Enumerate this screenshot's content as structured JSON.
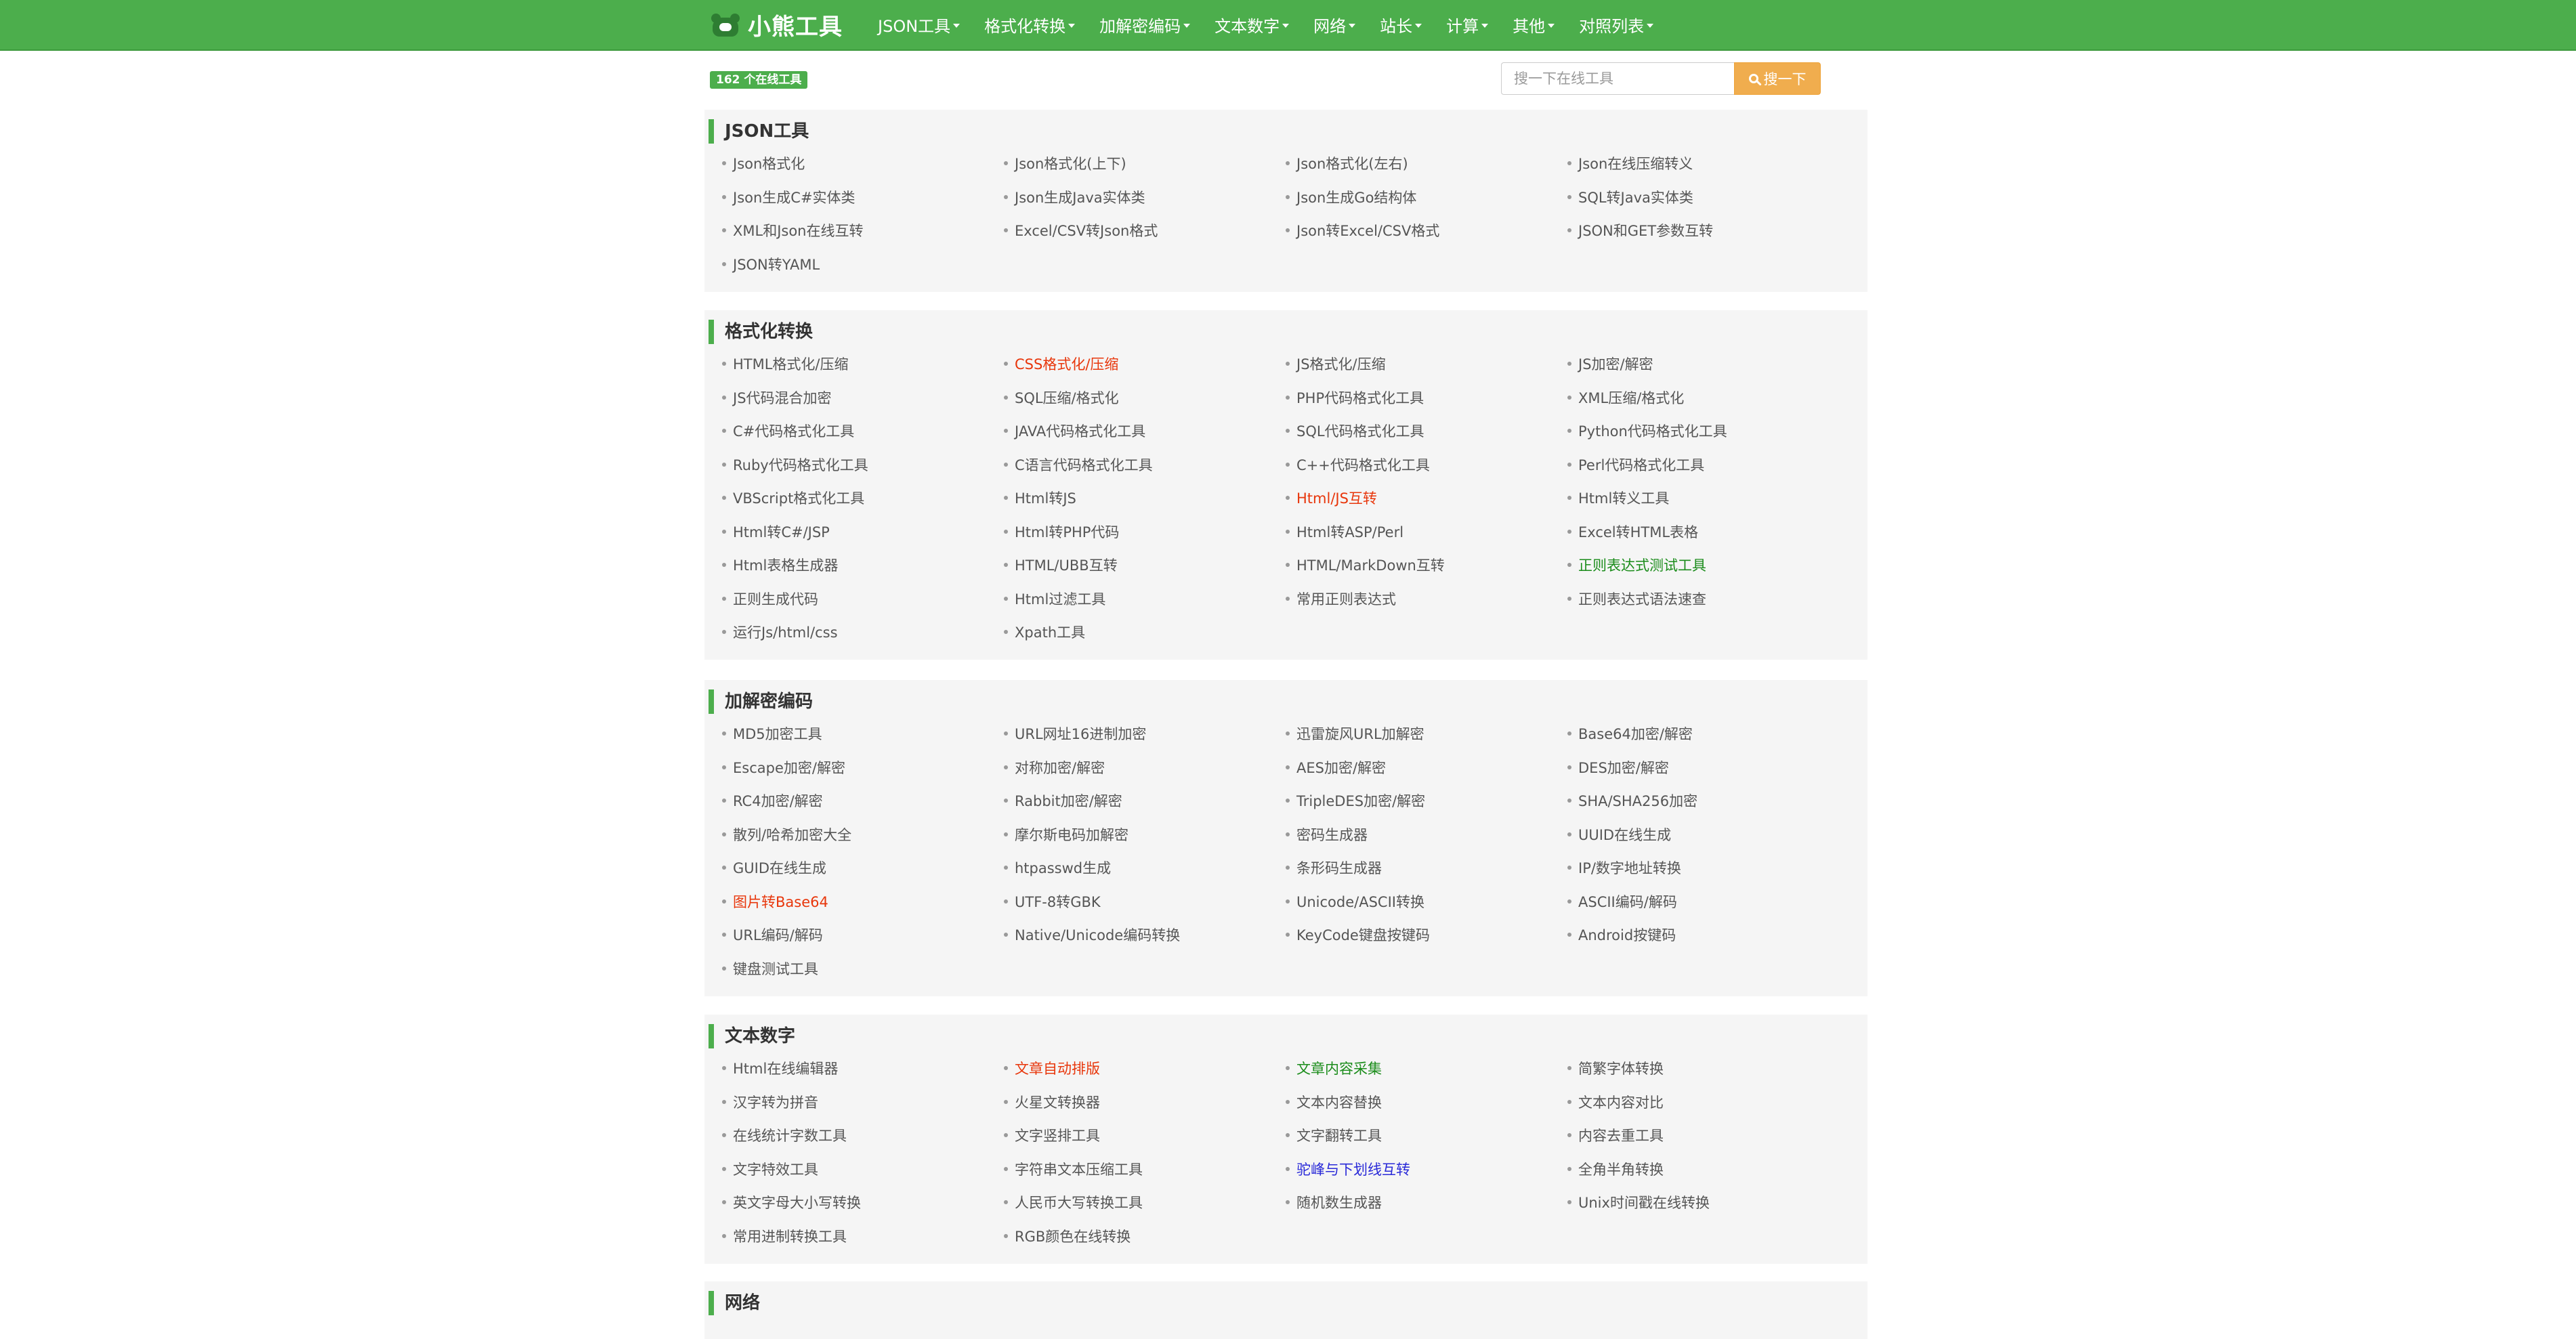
{
  "brand": {
    "name": "小熊工具",
    "logo_icon": "bear-icon"
  },
  "nav": [
    {
      "label": "JSON工具"
    },
    {
      "label": "格式化转换"
    },
    {
      "label": "加解密编码"
    },
    {
      "label": "文本数字"
    },
    {
      "label": "网络"
    },
    {
      "label": "站长"
    },
    {
      "label": "计算"
    },
    {
      "label": "其他"
    },
    {
      "label": "对照列表"
    }
  ],
  "toolbar": {
    "tool_count": "162 个在线工具",
    "search_placeholder": "搜一下在线工具",
    "search_label": "搜一下"
  },
  "colors": {
    "accent": "#4cae4c",
    "search_button": "#f0ad4e",
    "red": "#e8360b",
    "green": "#1a8c1a",
    "blue": "#2a2ad8"
  },
  "sections": [
    {
      "title": "JSON工具",
      "items": [
        {
          "label": "Json格式化",
          "color": "default"
        },
        {
          "label": "Json格式化(上下)",
          "color": "default"
        },
        {
          "label": "Json格式化(左右)",
          "color": "default"
        },
        {
          "label": "Json在线压缩转义",
          "color": "default"
        },
        {
          "label": "Json生成C#实体类",
          "color": "default"
        },
        {
          "label": "Json生成Java实体类",
          "color": "default"
        },
        {
          "label": "Json生成Go结构体",
          "color": "default"
        },
        {
          "label": "SQL转Java实体类",
          "color": "default"
        },
        {
          "label": "XML和Json在线互转",
          "color": "default"
        },
        {
          "label": "Excel/CSV转Json格式",
          "color": "default"
        },
        {
          "label": "Json转Excel/CSV格式",
          "color": "default"
        },
        {
          "label": "JSON和GET参数互转",
          "color": "default"
        },
        {
          "label": "JSON转YAML",
          "color": "default"
        }
      ]
    },
    {
      "title": "格式化转换",
      "items": [
        {
          "label": "HTML格式化/压缩",
          "color": "default"
        },
        {
          "label": "CSS格式化/压缩",
          "color": "red"
        },
        {
          "label": "JS格式化/压缩",
          "color": "default"
        },
        {
          "label": "JS加密/解密",
          "color": "default"
        },
        {
          "label": "JS代码混合加密",
          "color": "default"
        },
        {
          "label": "SQL压缩/格式化",
          "color": "default"
        },
        {
          "label": "PHP代码格式化工具",
          "color": "default"
        },
        {
          "label": "XML压缩/格式化",
          "color": "default"
        },
        {
          "label": "C#代码格式化工具",
          "color": "default"
        },
        {
          "label": "JAVA代码格式化工具",
          "color": "default"
        },
        {
          "label": "SQL代码格式化工具",
          "color": "default"
        },
        {
          "label": "Python代码格式化工具",
          "color": "default"
        },
        {
          "label": "Ruby代码格式化工具",
          "color": "default"
        },
        {
          "label": "C语言代码格式化工具",
          "color": "default"
        },
        {
          "label": "C++代码格式化工具",
          "color": "default"
        },
        {
          "label": "Perl代码格式化工具",
          "color": "default"
        },
        {
          "label": "VBScript格式化工具",
          "color": "default"
        },
        {
          "label": "Html转JS",
          "color": "default"
        },
        {
          "label": "Html/JS互转",
          "color": "red"
        },
        {
          "label": "Html转义工具",
          "color": "default"
        },
        {
          "label": "Html转C#/JSP",
          "color": "default"
        },
        {
          "label": "Html转PHP代码",
          "color": "default"
        },
        {
          "label": "Html转ASP/Perl",
          "color": "default"
        },
        {
          "label": "Excel转HTML表格",
          "color": "default"
        },
        {
          "label": "Html表格生成器",
          "color": "default"
        },
        {
          "label": "HTML/UBB互转",
          "color": "default"
        },
        {
          "label": "HTML/MarkDown互转",
          "color": "default"
        },
        {
          "label": "正则表达式测试工具",
          "color": "green"
        },
        {
          "label": "正则生成代码",
          "color": "default"
        },
        {
          "label": "Html过滤工具",
          "color": "default"
        },
        {
          "label": "常用正则表达式",
          "color": "default"
        },
        {
          "label": "正则表达式语法速查",
          "color": "default"
        },
        {
          "label": "运行Js/html/css",
          "color": "default"
        },
        {
          "label": "Xpath工具",
          "color": "default"
        }
      ]
    },
    {
      "title": "加解密编码",
      "items": [
        {
          "label": "MD5加密工具",
          "color": "default"
        },
        {
          "label": "URL网址16进制加密",
          "color": "default"
        },
        {
          "label": "迅雷旋风URL加解密",
          "color": "default"
        },
        {
          "label": "Base64加密/解密",
          "color": "default"
        },
        {
          "label": "Escape加密/解密",
          "color": "default"
        },
        {
          "label": "对称加密/解密",
          "color": "default"
        },
        {
          "label": "AES加密/解密",
          "color": "default"
        },
        {
          "label": "DES加密/解密",
          "color": "default"
        },
        {
          "label": "RC4加密/解密",
          "color": "default"
        },
        {
          "label": "Rabbit加密/解密",
          "color": "default"
        },
        {
          "label": "TripleDES加密/解密",
          "color": "default"
        },
        {
          "label": "SHA/SHA256加密",
          "color": "default"
        },
        {
          "label": "散列/哈希加密大全",
          "color": "default"
        },
        {
          "label": "摩尔斯电码加解密",
          "color": "default"
        },
        {
          "label": "密码生成器",
          "color": "default"
        },
        {
          "label": "UUID在线生成",
          "color": "default"
        },
        {
          "label": "GUID在线生成",
          "color": "default"
        },
        {
          "label": "htpasswd生成",
          "color": "default"
        },
        {
          "label": "条形码生成器",
          "color": "default"
        },
        {
          "label": "IP/数字地址转换",
          "color": "default"
        },
        {
          "label": "图片转Base64",
          "color": "red"
        },
        {
          "label": "UTF-8转GBK",
          "color": "default"
        },
        {
          "label": "Unicode/ASCII转换",
          "color": "default"
        },
        {
          "label": "ASCII编码/解码",
          "color": "default"
        },
        {
          "label": "URL编码/解码",
          "color": "default"
        },
        {
          "label": "Native/Unicode编码转换",
          "color": "default"
        },
        {
          "label": "KeyCode键盘按键码",
          "color": "default"
        },
        {
          "label": "Android按键码",
          "color": "default"
        },
        {
          "label": "键盘测试工具",
          "color": "default"
        }
      ]
    },
    {
      "title": "文本数字",
      "items": [
        {
          "label": "Html在线编辑器",
          "color": "default"
        },
        {
          "label": "文章自动排版",
          "color": "red"
        },
        {
          "label": "文章内容采集",
          "color": "green"
        },
        {
          "label": "简繁字体转换",
          "color": "default"
        },
        {
          "label": "汉字转为拼音",
          "color": "default"
        },
        {
          "label": "火星文转换器",
          "color": "default"
        },
        {
          "label": "文本内容替换",
          "color": "default"
        },
        {
          "label": "文本内容对比",
          "color": "default"
        },
        {
          "label": "在线统计字数工具",
          "color": "default"
        },
        {
          "label": "文字竖排工具",
          "color": "default"
        },
        {
          "label": "文字翻转工具",
          "color": "default"
        },
        {
          "label": "内容去重工具",
          "color": "default"
        },
        {
          "label": "文字特效工具",
          "color": "default"
        },
        {
          "label": "字符串文本压缩工具",
          "color": "default"
        },
        {
          "label": "驼峰与下划线互转",
          "color": "blue"
        },
        {
          "label": "全角半角转换",
          "color": "default"
        },
        {
          "label": "英文字母大小写转换",
          "color": "default"
        },
        {
          "label": "人民币大写转换工具",
          "color": "default"
        },
        {
          "label": "随机数生成器",
          "color": "default"
        },
        {
          "label": "Unix时间戳在线转换",
          "color": "default"
        },
        {
          "label": "常用进制转换工具",
          "color": "default"
        },
        {
          "label": "RGB颜色在线转换",
          "color": "default"
        }
      ]
    },
    {
      "title": "网络",
      "items": []
    }
  ]
}
